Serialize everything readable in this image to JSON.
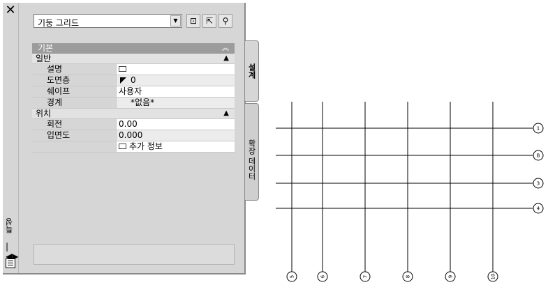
{
  "palette": {
    "title": "특성",
    "style": {
      "value": "기둥 그리드"
    },
    "categories": [
      {
        "label": "기본",
        "groups": [
          {
            "label": "일반",
            "rows": [
              {
                "name": "설명",
                "value": ""
              },
              {
                "name": "도면층",
                "value": "0"
              },
              {
                "name": "쉐이프",
                "value": "사용자"
              },
              {
                "name": "경계",
                "value": "*없음*"
              }
            ]
          },
          {
            "label": "위치",
            "rows": [
              {
                "name": "회전",
                "value": "0.00"
              },
              {
                "name": "입면도",
                "value": "0.000"
              },
              {
                "name": "",
                "value": "추가 정보"
              }
            ]
          }
        ]
      }
    ],
    "tabs": [
      "설계",
      "확장 데이터"
    ]
  },
  "grid_drawing": {
    "row_bubbles": [
      "1",
      "B",
      "3",
      "4"
    ],
    "column_bubbles": [
      "5",
      "6",
      "7",
      "8",
      "9",
      "10"
    ]
  }
}
